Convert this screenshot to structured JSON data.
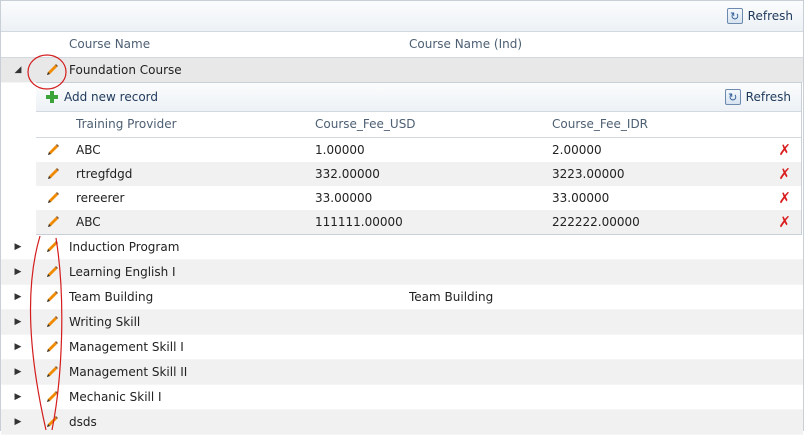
{
  "toolbar": {
    "refresh_label": "Refresh"
  },
  "columns": [
    "Course Name",
    "Course Name (Ind)"
  ],
  "expanded_course": {
    "name": "Foundation Course",
    "name_ind": ""
  },
  "detail": {
    "add_label": "Add new record",
    "refresh_label": "Refresh",
    "columns": [
      "Training Provider",
      "Course_Fee_USD",
      "Course_Fee_IDR"
    ],
    "rows": [
      {
        "provider": "ABC",
        "usd": "1.00000",
        "idr": "2.00000"
      },
      {
        "provider": "rtregfdgd",
        "usd": "332.00000",
        "idr": "3223.00000"
      },
      {
        "provider": "rereerer",
        "usd": "33.00000",
        "idr": "33.00000"
      },
      {
        "provider": "ABC",
        "usd": "111111.00000",
        "idr": "222222.00000"
      }
    ]
  },
  "courses": [
    {
      "name": "Induction Program",
      "name_ind": ""
    },
    {
      "name": "Learning English I",
      "name_ind": ""
    },
    {
      "name": "Team Building",
      "name_ind": "Team Building"
    },
    {
      "name": "Writing Skill",
      "name_ind": ""
    },
    {
      "name": "Management Skill I",
      "name_ind": ""
    },
    {
      "name": "Management Skill II",
      "name_ind": ""
    },
    {
      "name": "Mechanic Skill I",
      "name_ind": ""
    },
    {
      "name": "dsds",
      "name_ind": ""
    }
  ],
  "colors": {
    "accent": "#1e395b",
    "delete": "#d81e1e",
    "annotation": "#d41c1c"
  }
}
